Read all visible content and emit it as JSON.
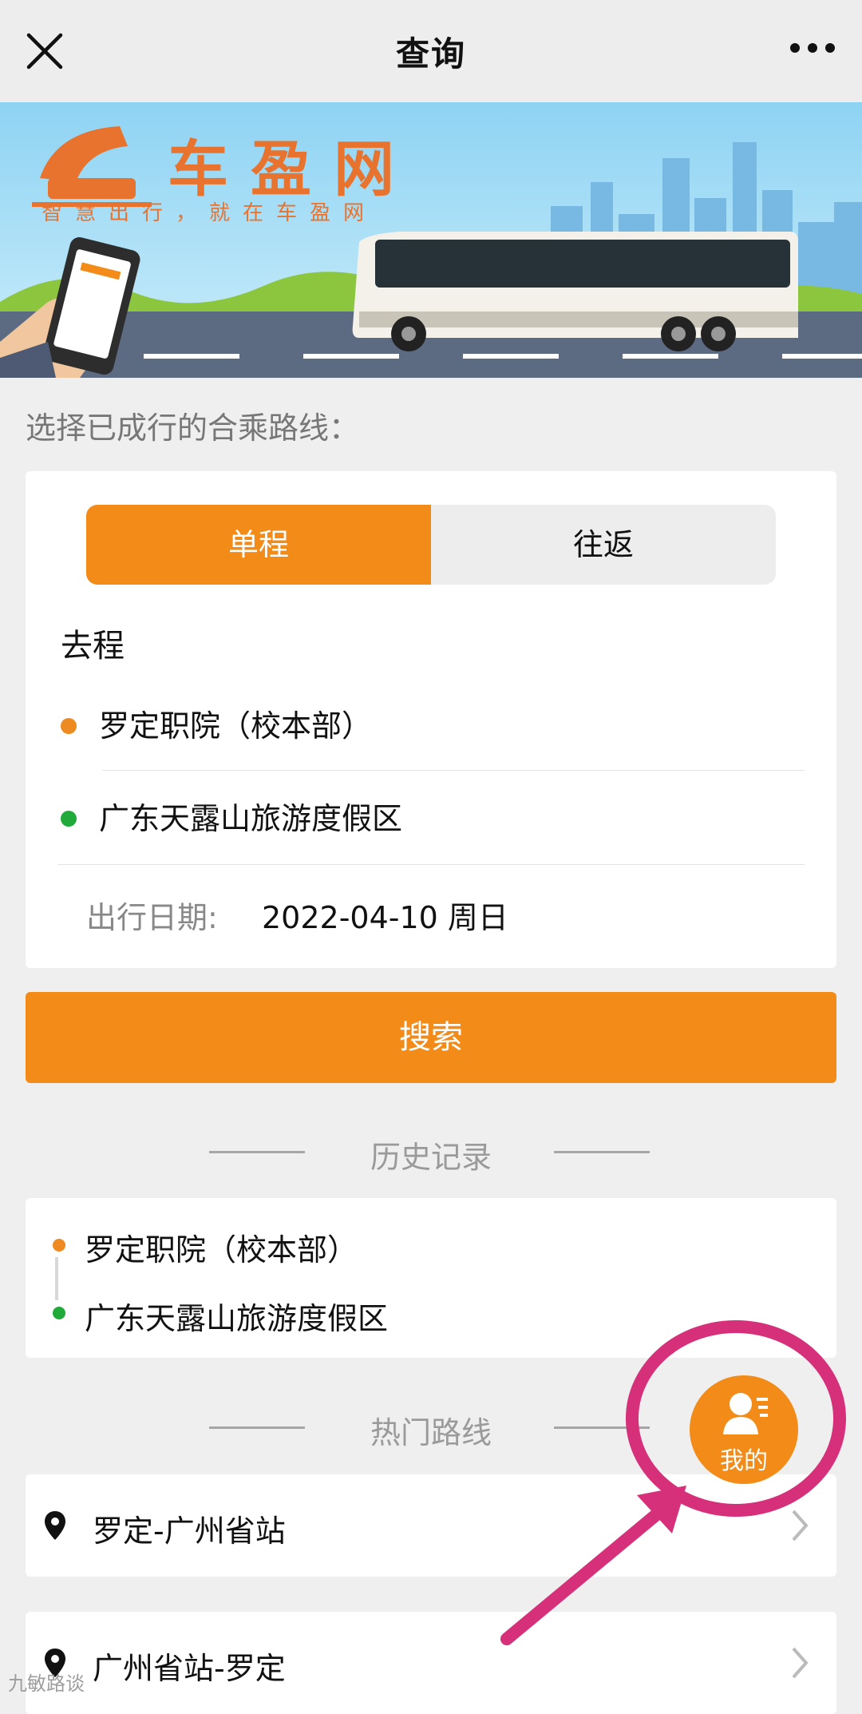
{
  "topbar": {
    "title": "查询"
  },
  "banner": {
    "brand": "车盈网",
    "slogan": "智慧出行，就在车盈网"
  },
  "hint": "选择已成行的合乘路线：",
  "trip_type": {
    "oneway": "单程",
    "roundtrip": "往返",
    "selected": "oneway"
  },
  "outbound": {
    "label": "去程",
    "from": "罗定职院（校本部）",
    "to": "广东天露山旅游度假区",
    "date_label": "出行日期:",
    "date_value": "2022-04-10 周日"
  },
  "search_button": "搜索",
  "history": {
    "title": "历史记录",
    "from": "罗定职院（校本部）",
    "to": "广东天露山旅游度假区"
  },
  "hot_routes": {
    "title": "热门路线",
    "items": [
      {
        "label": "罗定-广州省站"
      },
      {
        "label": "广州省站-罗定"
      }
    ]
  },
  "mine_button": {
    "label": "我的"
  },
  "watermark": "九敏路谈",
  "colors": {
    "accent": "#f28b18",
    "origin_dot": "#ee8a22",
    "destination_dot": "#1faa3a",
    "annotation": "#d6307a"
  }
}
